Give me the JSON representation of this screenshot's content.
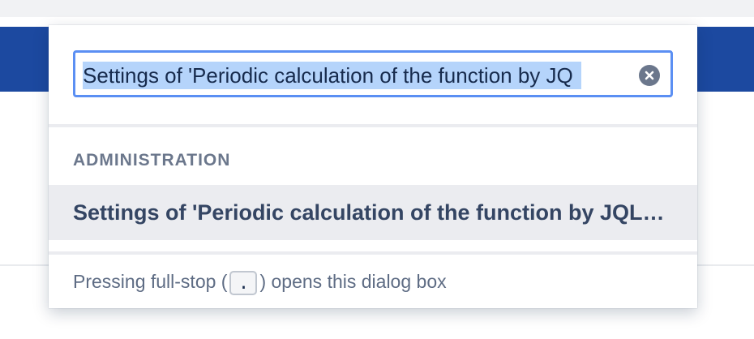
{
  "search": {
    "value": "Settings of 'Periodic calculation of the function by JQ",
    "clear_icon": "clear-icon"
  },
  "results": {
    "section_label": "ADMINISTRATION",
    "items": [
      {
        "label": "Settings of 'Periodic calculation of the function by JQL' job"
      }
    ]
  },
  "footer": {
    "text_before": "Pressing full-stop (",
    "key": ".",
    "text_after": ") opens this dialog box"
  },
  "colors": {
    "header_blue": "#1c49a0",
    "focus_border": "#5b8ff3",
    "selection": "#b5d4fb",
    "highlight_row": "#ebecf0"
  }
}
